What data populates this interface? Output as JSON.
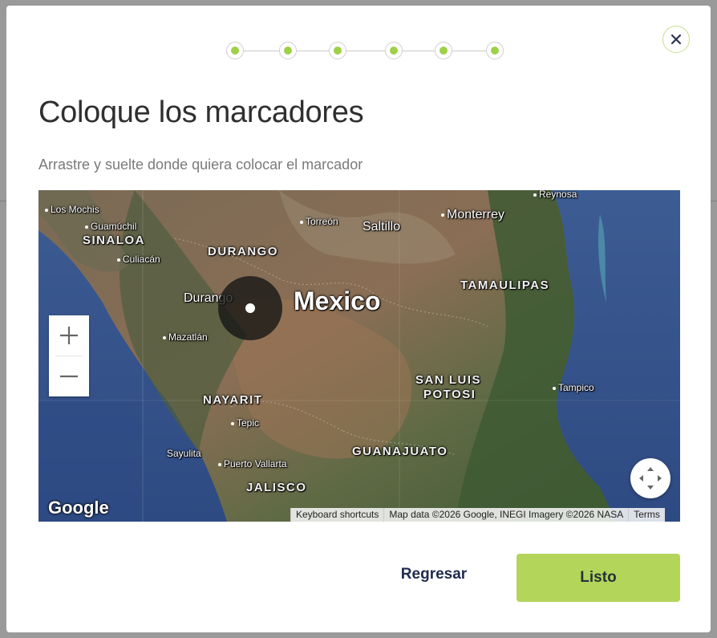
{
  "stepper": {
    "steps": 6,
    "active_color": "#9ed048"
  },
  "dialog": {
    "title": "Coloque los marcadores",
    "subtitle": "Arrastre y suelte donde quiera colocar el marcador",
    "close_icon": "close-icon"
  },
  "map": {
    "type": "satellite",
    "country_label": "Mexico",
    "cities": {
      "los_mochis": "Los Mochis",
      "guamuchil": "Guamúchil",
      "culiacan": "Culiacán",
      "torreon": "Torreón",
      "saltillo": "Saltillo",
      "monterrey": "Monterrey",
      "reynosa": "Reynosa",
      "durango": "Durango",
      "mazatlan": "Mazatlán",
      "tepic": "Tepic",
      "tampico": "Tampico",
      "sayulita": "Sayulita",
      "puerto_vallarta": "Puerto Vallarta"
    },
    "states": {
      "sinaloa": "SINALOA",
      "durango": "DURANGO",
      "tamaulipas": "TAMAULIPAS",
      "nayarit": "NAYARIT",
      "san_luis_potosi_1": "SAN LUIS",
      "san_luis_potosi_2": "POTOSI",
      "guanajuato": "GUANAJUATO",
      "jalisco": "JALISCO"
    },
    "zoom_in_label": "+",
    "zoom_out_label": "−",
    "logo": "Google",
    "attribution": {
      "shortcuts": "Keyboard shortcuts",
      "data": "Map data ©2026 Google, INEGI Imagery ©2026 NASA",
      "terms": "Terms"
    }
  },
  "footer": {
    "back_label": "Regresar",
    "done_label": "Listo",
    "done_color": "#b3d55a"
  }
}
